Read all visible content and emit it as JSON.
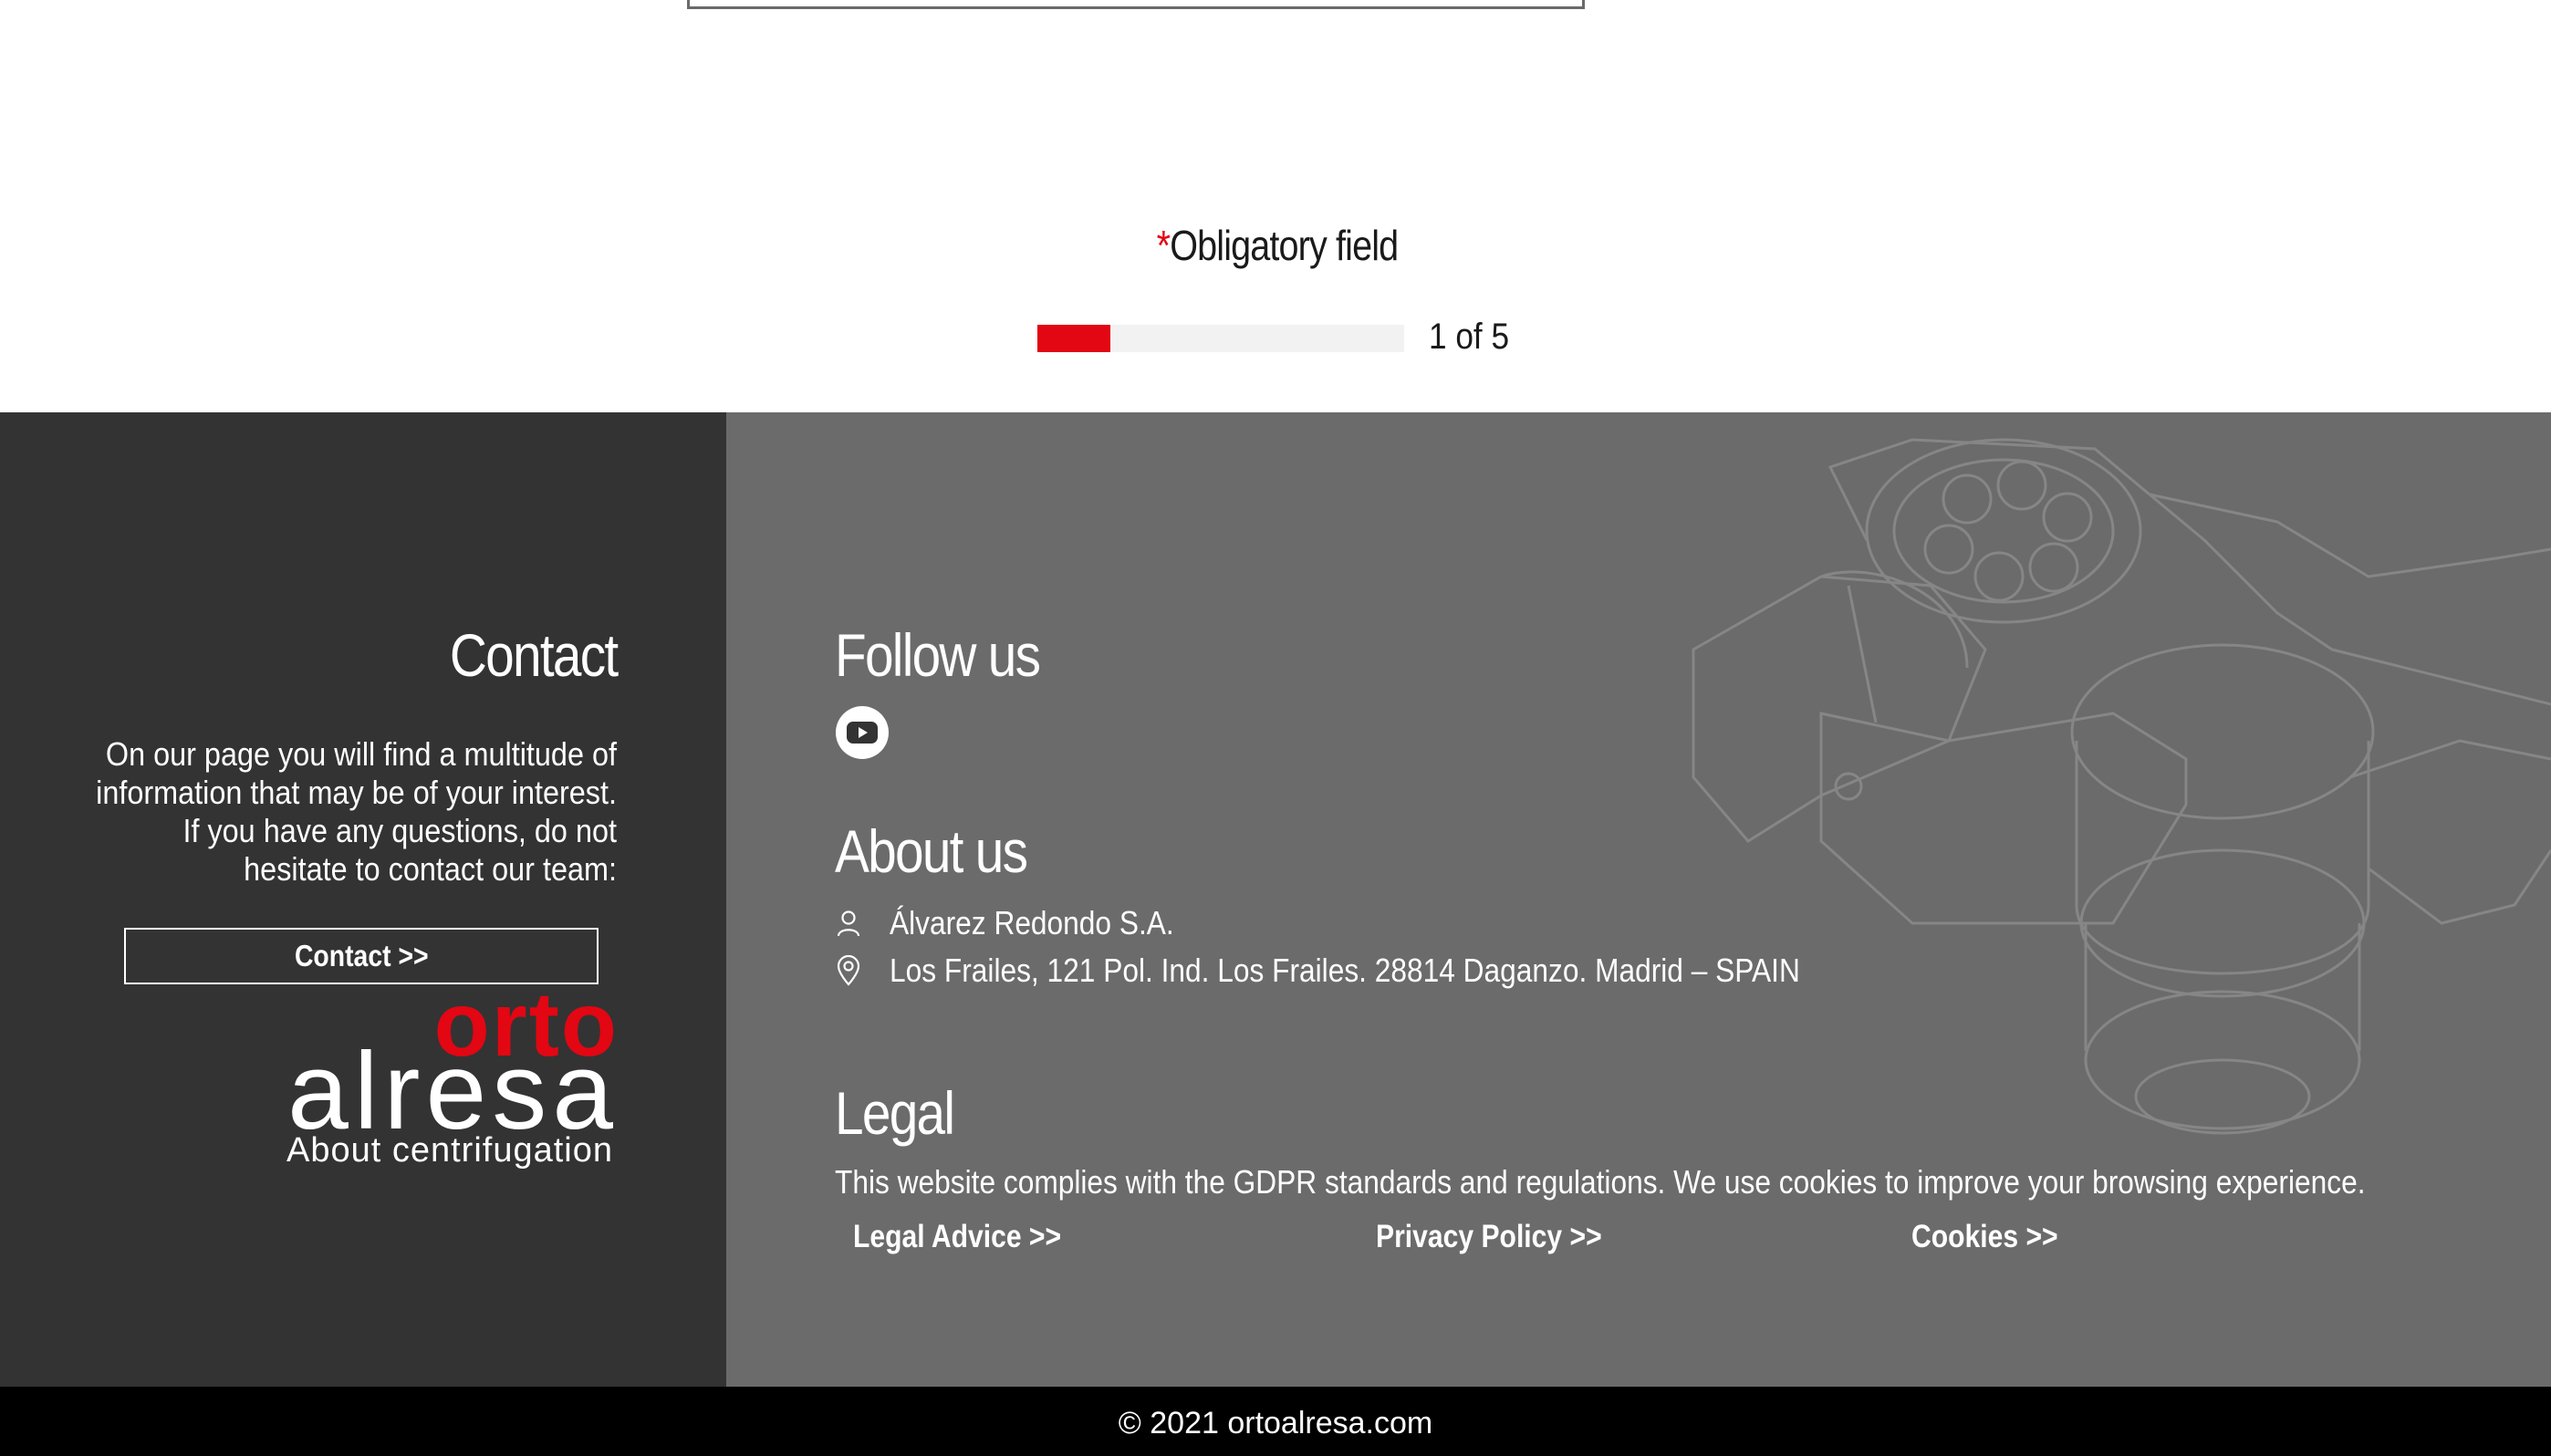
{
  "form": {
    "required_marker": "*",
    "obligatory_label": "Obligatory field",
    "progress": {
      "current": 1,
      "total": 5,
      "fraction": 0.2,
      "text": "1 of 5"
    }
  },
  "footer": {
    "contact": {
      "title": "Contact",
      "body": "On our page you will find a multitude of information that may be of your interest. If you have any questions, do not hesitate to contact our team:",
      "button_label": "Contact >>"
    },
    "logo": {
      "top": "orto",
      "main": "alresa",
      "tagline": "About centrifugation"
    },
    "follow": {
      "title": "Follow us",
      "icons": [
        "youtube-icon"
      ]
    },
    "about": {
      "title": "About us",
      "company": "Álvarez Redondo S.A.",
      "address": "Los Frailes, 121 Pol. Ind. Los Frailes. 28814 Daganzo. Madrid – SPAIN"
    },
    "legal": {
      "title": "Legal",
      "text": "This website complies with the GDPR standards and regulations. We use cookies to improve your browsing experience.",
      "links": {
        "legal_advice": "Legal Advice >>",
        "privacy_policy": "Privacy Policy >>",
        "cookies": "Cookies >>"
      }
    },
    "copyright": "© 2021 ortoalresa.com"
  },
  "colors": {
    "accent": "#e30613",
    "footer_left": "#333333",
    "footer_right": "#6b6b6b",
    "bottom_bar": "#000000"
  }
}
